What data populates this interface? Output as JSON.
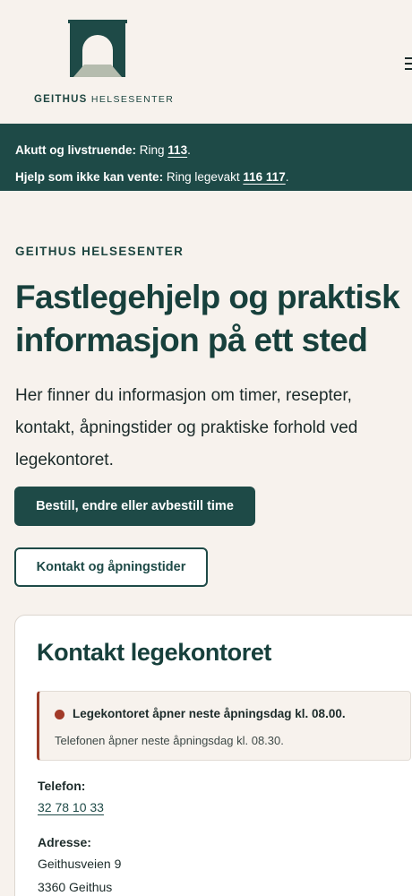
{
  "logo": {
    "brand_bold": "GEITHUS",
    "brand_rest": "HELSESENTER"
  },
  "colors": {
    "primary": "#1e4a47",
    "background": "#f7f2ed",
    "status_dot": "#a23a28"
  },
  "alert": {
    "line1_label": "Akutt og livstruende:",
    "line1_text": " Ring ",
    "line1_number": "113",
    "line1_end": ".",
    "line2_label": "Hjelp som ikke kan vente:",
    "line2_text": " Ring legevakt ",
    "line2_number": "116 117",
    "line2_end": "."
  },
  "hero": {
    "eyebrow": "GEITHUS HELSESENTER",
    "title_line1": "Fastlegehjelp og praktisk",
    "title_line2": "informasjon på ett sted",
    "text": "Her finner du informasjon om timer, resepter, kontakt, åpningstider og praktiske forhold ved legekontoret.",
    "primary_button": "Bestill, endre eller avbestill time",
    "secondary_button": "Kontakt og åpningstider"
  },
  "contact": {
    "title": "Kontakt legekontoret",
    "status_main": "Legekontoret åpner neste åpningsdag kl. 08.00.",
    "status_sub": "Telefonen åpner neste åpningsdag kl. 08.30.",
    "phone_label": "Telefon:",
    "phone": "32 78 10 33",
    "address_label": "Adresse:",
    "address_line1": "Geithusveien 9",
    "address_line2": "3360 Geithus"
  }
}
